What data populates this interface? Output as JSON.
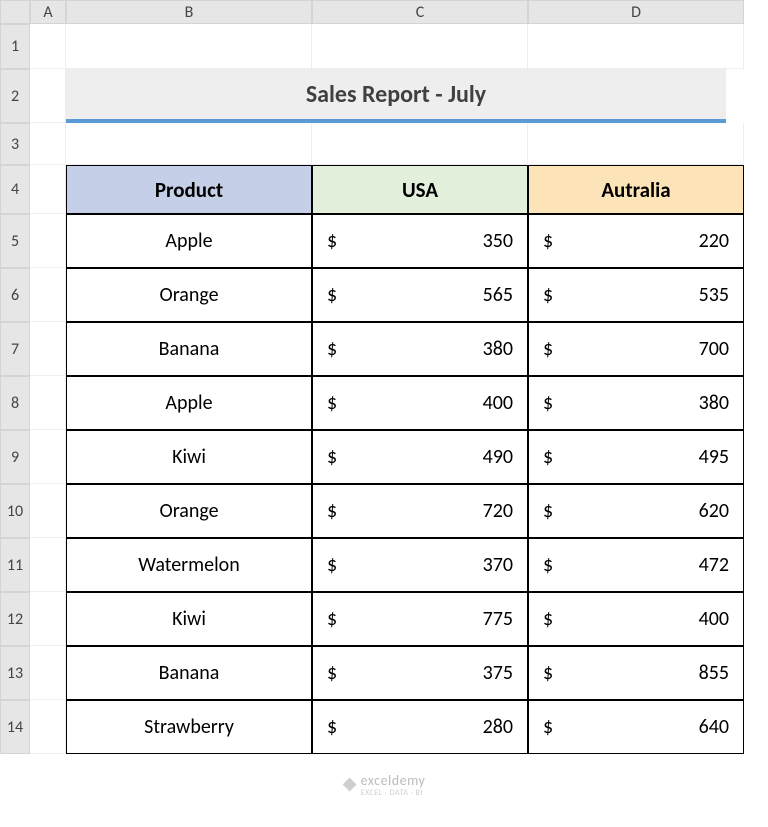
{
  "columns": [
    "A",
    "B",
    "C",
    "D"
  ],
  "rows": [
    "1",
    "2",
    "3",
    "4",
    "5",
    "6",
    "7",
    "8",
    "9",
    "10",
    "11",
    "12",
    "13",
    "14"
  ],
  "title": "Sales Report - July",
  "headers": {
    "product": "Product",
    "usa": "USA",
    "australia": "Autralia"
  },
  "currency": "$",
  "data": [
    {
      "product": "Apple",
      "usa": 350,
      "aus": 220
    },
    {
      "product": "Orange",
      "usa": 565,
      "aus": 535
    },
    {
      "product": "Banana",
      "usa": 380,
      "aus": 700
    },
    {
      "product": "Apple",
      "usa": 400,
      "aus": 380
    },
    {
      "product": "Kiwi",
      "usa": 490,
      "aus": 495
    },
    {
      "product": "Orange",
      "usa": 720,
      "aus": 620
    },
    {
      "product": "Watermelon",
      "usa": 370,
      "aus": 472
    },
    {
      "product": "Kiwi",
      "usa": 775,
      "aus": 400
    },
    {
      "product": "Banana",
      "usa": 375,
      "aus": 855
    },
    {
      "product": "Strawberry",
      "usa": 280,
      "aus": 640
    }
  ],
  "watermark": {
    "brand": "exceldemy",
    "tagline": "EXCEL · DATA · BI"
  }
}
